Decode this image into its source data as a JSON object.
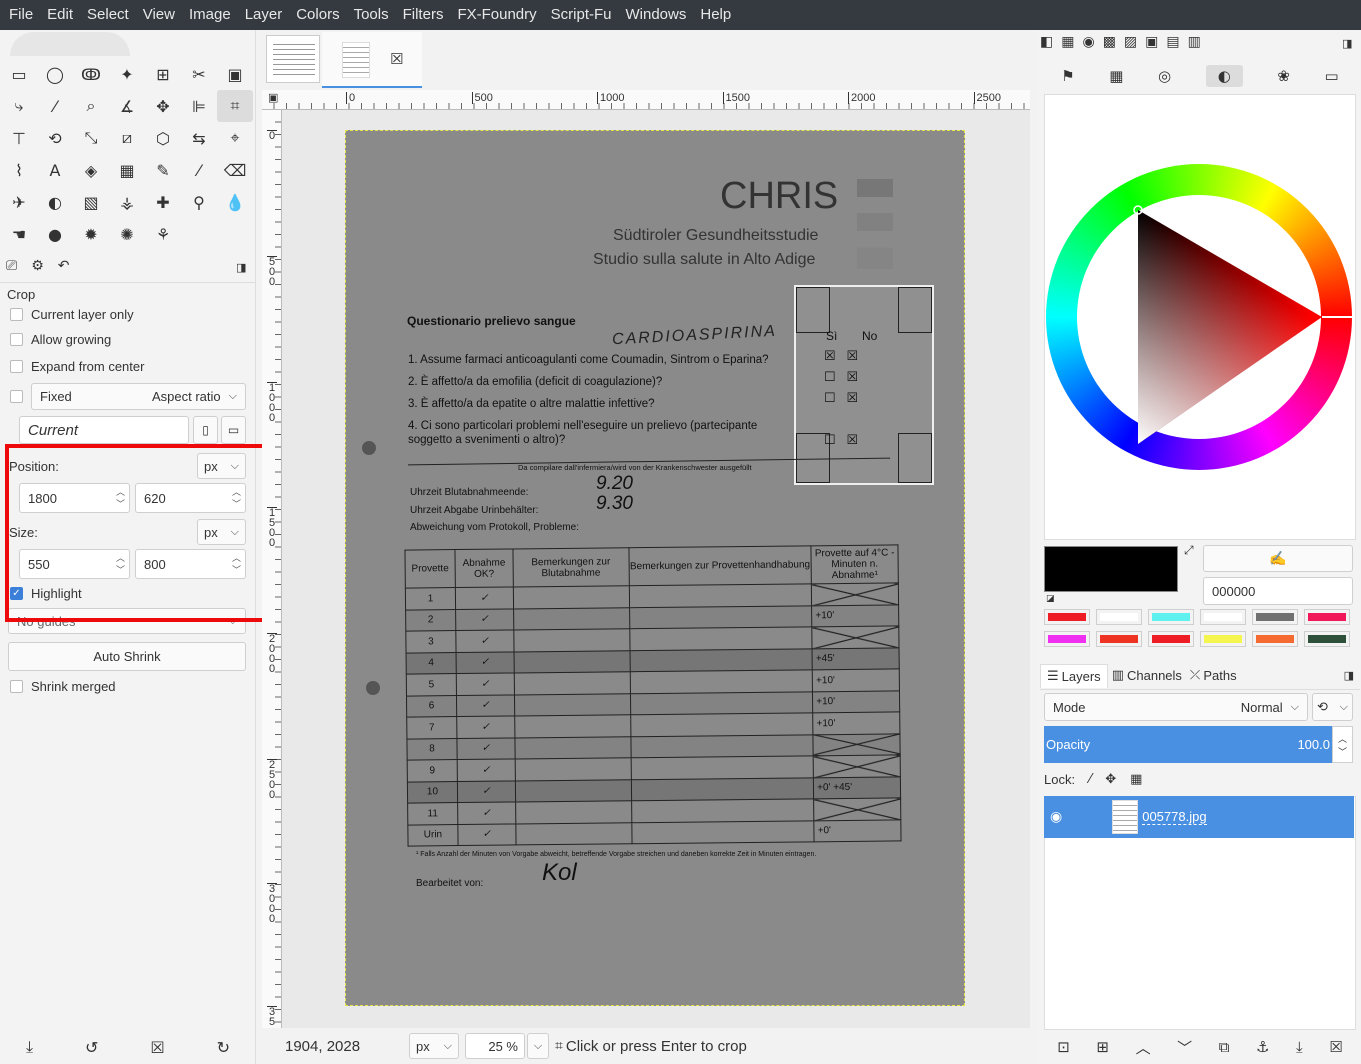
{
  "menubar": [
    "File",
    "Edit",
    "Select",
    "View",
    "Image",
    "Layer",
    "Colors",
    "Tools",
    "Filters",
    "FX-Foundry",
    "Script-Fu",
    "Windows",
    "Help"
  ],
  "tools": [
    {
      "name": "rect-select-icon",
      "glyph": "▭"
    },
    {
      "name": "ellipse-select-icon",
      "glyph": "◯"
    },
    {
      "name": "free-select-icon",
      "glyph": "ↂ"
    },
    {
      "name": "fuzzy-select-icon",
      "glyph": "✦"
    },
    {
      "name": "by-color-select-icon",
      "glyph": "⊞"
    },
    {
      "name": "scissors-icon",
      "glyph": "✂"
    },
    {
      "name": "foreground-select-icon",
      "glyph": "▣"
    },
    {
      "name": "paths-icon",
      "glyph": "⤷"
    },
    {
      "name": "color-picker-icon",
      "glyph": "⁄"
    },
    {
      "name": "zoom-icon",
      "glyph": "⌕"
    },
    {
      "name": "measure-icon",
      "glyph": "∡"
    },
    {
      "name": "move-icon",
      "glyph": "✥"
    },
    {
      "name": "align-icon",
      "glyph": "⊫"
    },
    {
      "name": "crop-icon",
      "glyph": "⌗"
    },
    {
      "name": "unified-transform-icon",
      "glyph": "⊤"
    },
    {
      "name": "rotate-icon",
      "glyph": "⟲"
    },
    {
      "name": "scale-icon",
      "glyph": "⤡"
    },
    {
      "name": "shear-icon",
      "glyph": "⧄"
    },
    {
      "name": "perspective-icon",
      "glyph": "⬡"
    },
    {
      "name": "flip-icon",
      "glyph": "⇆"
    },
    {
      "name": "cage-icon",
      "glyph": "⌖"
    },
    {
      "name": "warp-icon",
      "glyph": "⌇"
    },
    {
      "name": "text-icon",
      "glyph": "A"
    },
    {
      "name": "bucket-fill-icon",
      "glyph": "◈"
    },
    {
      "name": "gradient-icon",
      "glyph": "▦"
    },
    {
      "name": "pencil-icon",
      "glyph": "✎"
    },
    {
      "name": "paintbrush-icon",
      "glyph": "⁄"
    },
    {
      "name": "eraser-icon",
      "glyph": "⌫"
    },
    {
      "name": "airbrush-icon",
      "glyph": "✈"
    },
    {
      "name": "ink-icon",
      "glyph": "◐"
    },
    {
      "name": "mypaint-brush-icon",
      "glyph": "▧"
    },
    {
      "name": "clone-icon",
      "glyph": "⚶"
    },
    {
      "name": "heal-icon",
      "glyph": "✚"
    },
    {
      "name": "perspective-clone-icon",
      "glyph": "⚲"
    },
    {
      "name": "blur-icon",
      "glyph": "💧"
    },
    {
      "name": "smudge-icon",
      "glyph": "☚"
    },
    {
      "name": "dodge-burn-icon",
      "glyph": "●"
    },
    {
      "name": "gimp-icon",
      "glyph": "✹"
    },
    {
      "name": "filters-icon",
      "glyph": "✺"
    },
    {
      "name": "handle-transform-icon",
      "glyph": "⚘"
    }
  ],
  "tool_options": {
    "title": "Crop",
    "current_layer_only": "Current layer only",
    "allow_growing": "Allow growing",
    "expand_from_center": "Expand from center",
    "fixed": "Fixed",
    "aspect_ratio": "Aspect ratio",
    "current": "Current",
    "position_label": "Position:",
    "position_unit": "px",
    "position_x": "1800",
    "position_y": "620",
    "size_label": "Size:",
    "size_unit": "px",
    "size_w": "550",
    "size_h": "800",
    "highlight": "Highlight",
    "guides": "No guides",
    "auto_shrink": "Auto Shrink",
    "shrink_merged": "Shrink merged"
  },
  "ruler_h": [
    "0",
    "500",
    "1000",
    "1500",
    "2000",
    "2500"
  ],
  "ruler_v": [
    {
      "label": "0",
      "digits": [
        "0"
      ]
    },
    {
      "label": "500",
      "digits": [
        "5",
        "0",
        "0"
      ]
    },
    {
      "label": "1000",
      "digits": [
        "1",
        "0",
        "0",
        "0"
      ]
    },
    {
      "label": "1500",
      "digits": [
        "1",
        "5",
        "0",
        "0"
      ]
    },
    {
      "label": "2000",
      "digits": [
        "2",
        "0",
        "0",
        "0"
      ]
    },
    {
      "label": "2500",
      "digits": [
        "2",
        "5",
        "0",
        "0"
      ]
    },
    {
      "label": "3000",
      "digits": [
        "3",
        "0",
        "0",
        "0"
      ]
    },
    {
      "label": "35",
      "digits": [
        "3",
        "5"
      ]
    }
  ],
  "document": {
    "brand": "CHRIS",
    "subtitle1": "Südtiroler Gesundheitsstudie",
    "subtitle2": "Studio sulla salute in Alto Adige",
    "questionnaire_title": "Questionario prelievo sangue",
    "handwritten_title": "CARDIOASPIRINA",
    "si": "Sì",
    "no": "No",
    "questions": [
      "1.  Assume farmaci anticoagulanti come Coumadin, Sintrom o Eparina?",
      "2.  È affetto/a da emofilia (deficit di coagulazione)?",
      "3.  È affetto/a da epatite o altre malattie infettive?",
      "4.  Ci sono particolari problemi nell'eseguire un prelievo (partecipante",
      "     soggetto a svenimenti o altro)?"
    ],
    "nurse_note": "Da compilare dall'infermiera/wird von der Krankenschwester ausgefüllt",
    "time1_label": "Uhrzeit Blutabnahmeende:",
    "time1_value": "9.20",
    "time2_label": "Uhrzeit Abgabe Urinbehälter:",
    "time2_value": "9.30",
    "deviation_label": "Abweichung vom Protokoll, Probleme:",
    "table_headers": [
      "Provette",
      "Abnahme OK?",
      "Bemerkungen zur Blutabnahme",
      "Bemerkungen zur Provettenhandhabung",
      "Provette auf 4°C - Minuten n. Abnahme¹"
    ],
    "table_rows": [
      {
        "id": "1",
        "note": ""
      },
      {
        "id": "2",
        "note": "+10'"
      },
      {
        "id": "3",
        "note": ""
      },
      {
        "id": "4",
        "note": "+45'"
      },
      {
        "id": "5",
        "note": "+10'"
      },
      {
        "id": "6",
        "note": "+10'"
      },
      {
        "id": "7",
        "note": "+10'"
      },
      {
        "id": "8",
        "note": ""
      },
      {
        "id": "9",
        "note": ""
      },
      {
        "id": "10",
        "note": "+0'    +45'"
      },
      {
        "id": "11",
        "note": ""
      },
      {
        "id": "Urin",
        "note": "+0'"
      }
    ],
    "footnote": "¹ Falls Anzahl der Minuten von Vorgabe abweicht, betreffende Vorgabe streichen und daneben korrekte Zeit in Minuten eintragen.",
    "processed_by": "Bearbeitet von:",
    "signature": "Kol"
  },
  "status": {
    "coords": "1904, 2028",
    "unit": "px",
    "zoom": "25 %",
    "message": "Click or press Enter to crop"
  },
  "colors": {
    "fg_hex": "000000",
    "palette": [
      "#ee1c25",
      "#ffffff",
      "#5ff0f0",
      "#ffffff",
      "#707070",
      "#f01858",
      "#f030f0",
      "#ee3322",
      "#ee1c25",
      "#f5f550",
      "#f56a30",
      "#2e4f3a"
    ],
    "accent": "#4a90e2"
  },
  "layers": {
    "tabs": [
      "Layers",
      "Channels",
      "Paths"
    ],
    "mode_label": "Mode",
    "mode_value": "Normal",
    "opacity_label": "Opacity",
    "opacity_value": "100.0",
    "lock_label": "Lock:",
    "layer_name": "005778.jpg"
  }
}
